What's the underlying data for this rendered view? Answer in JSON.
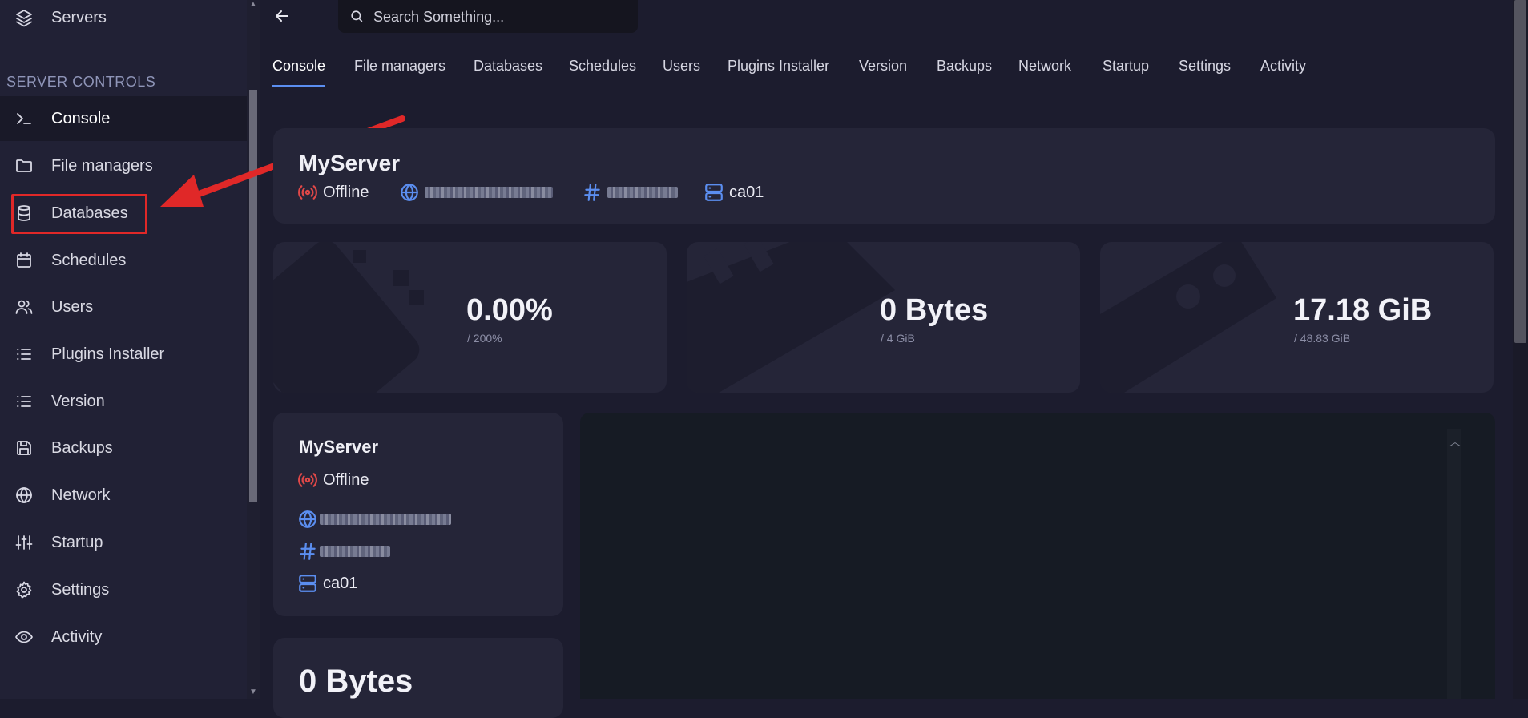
{
  "sidebar": {
    "top_item": {
      "label": "Servers",
      "icon": "layers-icon"
    },
    "section_title": "SERVER CONTROLS",
    "items": [
      {
        "label": "Console",
        "icon": "terminal-icon",
        "active": true
      },
      {
        "label": "File managers",
        "icon": "folder-icon"
      },
      {
        "label": "Databases",
        "icon": "database-icon"
      },
      {
        "label": "Schedules",
        "icon": "calendar-icon"
      },
      {
        "label": "Users",
        "icon": "users-icon"
      },
      {
        "label": "Plugins Installer",
        "icon": "list-icon"
      },
      {
        "label": "Version",
        "icon": "list-icon"
      },
      {
        "label": "Backups",
        "icon": "save-icon"
      },
      {
        "label": "Network",
        "icon": "globe-icon"
      },
      {
        "label": "Startup",
        "icon": "sliders-icon"
      },
      {
        "label": "Settings",
        "icon": "gear-icon"
      },
      {
        "label": "Activity",
        "icon": "eye-icon"
      }
    ]
  },
  "search": {
    "placeholder": "Search Something..."
  },
  "tabs": [
    "Console",
    "File managers",
    "Databases",
    "Schedules",
    "Users",
    "Plugins Installer",
    "Version",
    "Backups",
    "Network",
    "Startup",
    "Settings",
    "Activity"
  ],
  "server_header": {
    "name": "MyServer",
    "status": "Offline",
    "node": "ca01"
  },
  "stats": [
    {
      "value": "0.00%",
      "limit": "/ 200%"
    },
    {
      "value": "0 Bytes",
      "limit": "/ 4 GiB"
    },
    {
      "value": "17.18 GiB",
      "limit": "/ 48.83 GiB"
    }
  ],
  "info_card": {
    "name": "MyServer",
    "status": "Offline",
    "node": "ca01"
  },
  "bottom_card": {
    "value": "0 Bytes"
  },
  "colors": {
    "accent": "#5b8ef0",
    "offline": "#e04848",
    "annotation": "#e02828"
  }
}
